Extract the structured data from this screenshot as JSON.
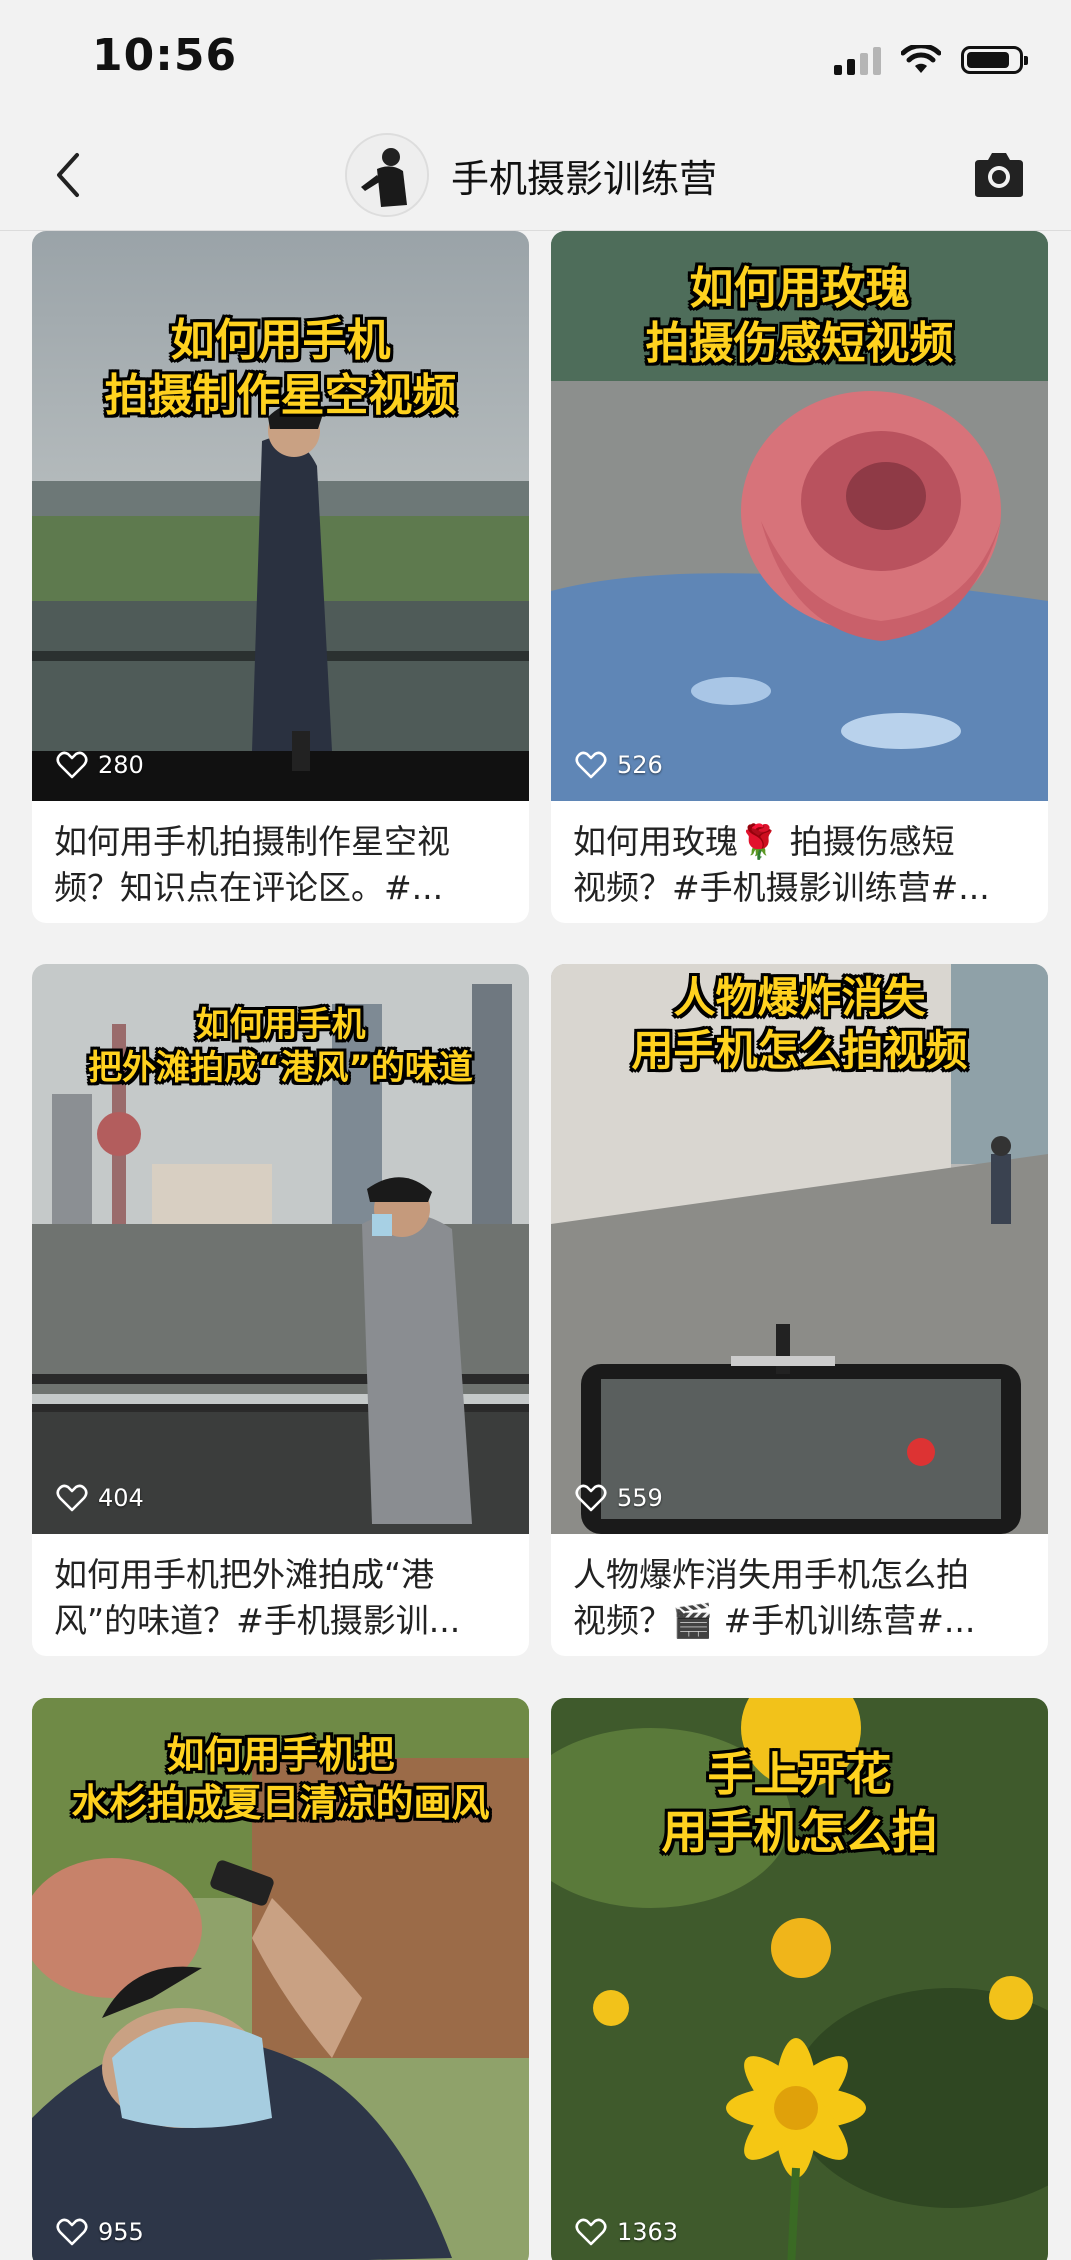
{
  "status_bar": {
    "time": "10:56"
  },
  "nav": {
    "title": "手机摄影训练营"
  },
  "posts": [
    {
      "overlay_line1": "如何用手机",
      "overlay_line2": "拍摄制作星空视频",
      "likes": "280",
      "caption_line1": "如何用手机拍摄制作星空视",
      "caption_line2": "频？知识点在评论区。#..."
    },
    {
      "overlay_line1": "如何用玫瑰",
      "overlay_line2": "拍摄伤感短视频",
      "likes": "526",
      "caption_line1": "如何用玫瑰🌹 拍摄伤感短",
      "caption_line2": "视频？#手机摄影训练营#..."
    },
    {
      "overlay_line1": "如何用手机",
      "overlay_line2": "把外滩拍成“港风”的味道",
      "likes": "404",
      "caption_line1": "如何用手机把外滩拍成“港",
      "caption_line2": "风”的味道？#手机摄影训..."
    },
    {
      "overlay_line1": "人物爆炸消失",
      "overlay_line2": "用手机怎么拍视频",
      "likes": "559",
      "caption_line1": "人物爆炸消失用手机怎么拍",
      "caption_line2": "视频？🎬 #手机训练营#..."
    },
    {
      "overlay_line1": "如何用手机把",
      "overlay_line2": "水杉拍成夏日清凉的画风",
      "likes": "955",
      "caption_line1": "",
      "caption_line2": ""
    },
    {
      "overlay_line1": "手上开花",
      "overlay_line2": "用手机怎么拍",
      "likes": "1363",
      "caption_line1": "",
      "caption_line2": ""
    }
  ],
  "icons": {
    "back": "chevron-left-icon",
    "camera": "camera-icon",
    "like": "heart-outline-icon",
    "signal": "cellular-signal-icon",
    "wifi": "wifi-icon",
    "battery": "battery-icon"
  },
  "colors": {
    "overlay_text": "#ffd21f",
    "background": "#f2f2f2"
  }
}
